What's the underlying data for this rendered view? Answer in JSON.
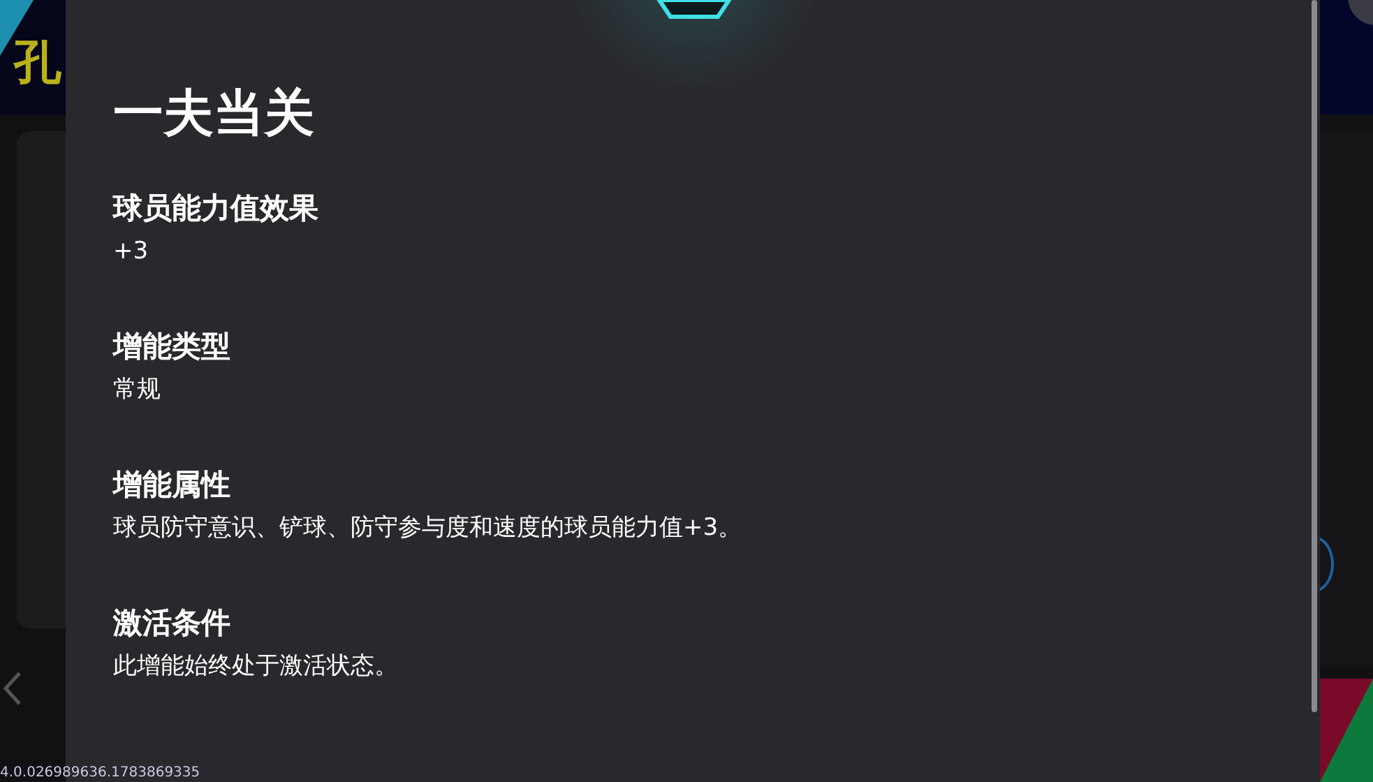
{
  "background": {
    "title_char": "孔",
    "version": "4.0.026989636.1783869335"
  },
  "dialog": {
    "title": "一夫当关",
    "sections": [
      {
        "heading": "球员能力值效果",
        "text": "+3"
      },
      {
        "heading": "增能类型",
        "text": "常规"
      },
      {
        "heading": "增能属性",
        "text": "球员防守意识、铲球、防守参与度和速度的球员能力值+3。"
      },
      {
        "heading": "激活条件",
        "text": "此增能始终处于激活状态。"
      }
    ]
  }
}
